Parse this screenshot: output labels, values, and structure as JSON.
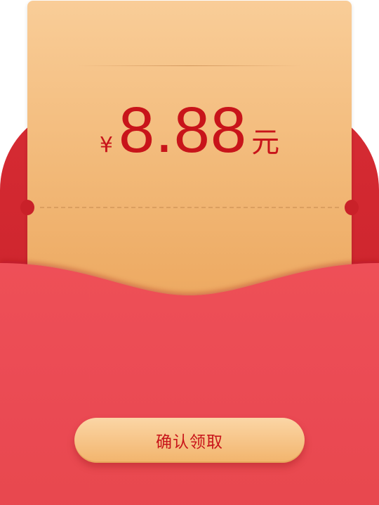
{
  "coupon": {
    "currency_symbol": "¥",
    "amount": "8.88",
    "unit": "元"
  },
  "actions": {
    "confirm_label": "确认领取"
  },
  "colors": {
    "envelope_red": "#e8474f",
    "envelope_back_red": "#c51f28",
    "coupon_gold": "#f3bc7d",
    "text_red": "#c8141a"
  }
}
